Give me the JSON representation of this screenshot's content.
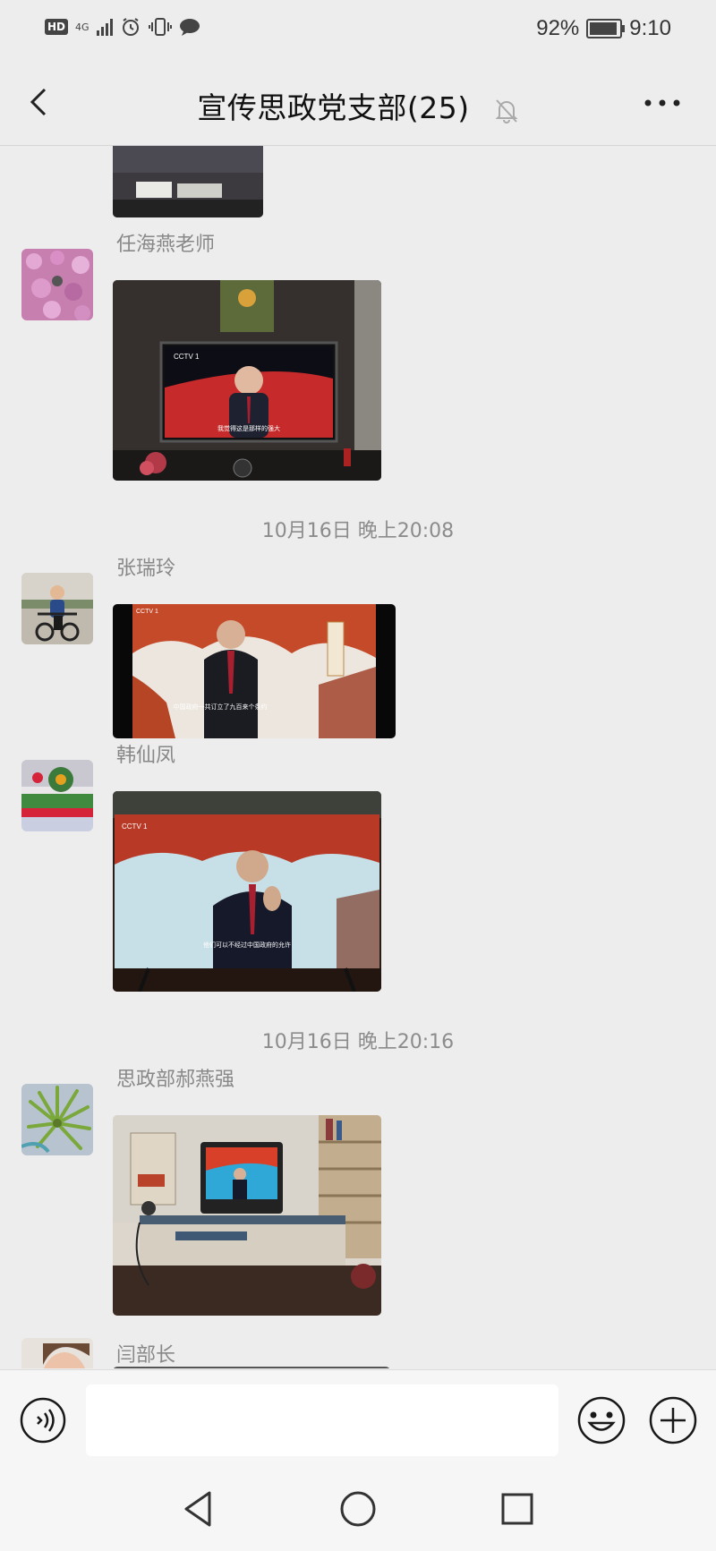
{
  "status_bar": {
    "hd": "HD",
    "network": "4G",
    "battery": "92%",
    "battery_level": 0.92,
    "time": "9:10"
  },
  "header": {
    "title": "宣传思政党支部(25)",
    "back_icon": "chevron-left-icon",
    "mute_icon": "bell-muted-icon",
    "more_icon": "more-dots-icon"
  },
  "messages": [
    {
      "sender": "任海燕老师"
    },
    {
      "time": "10月16日 晚上20:08"
    },
    {
      "sender": "张瑞玲"
    },
    {
      "sender": "韩仙凤"
    },
    {
      "time": "10月16日 晚上20:16"
    },
    {
      "sender": "思政部郝燕强"
    },
    {
      "sender": "闫部长"
    }
  ],
  "photo_captions": {
    "tv1_channel": "CCTV 1",
    "tv1_subtitle": "我觉得这是那样的强大",
    "tv2_channel": "CCTV 1",
    "tv2_subtitle": "中国政府一共订立了九百来个条约",
    "tv3_channel": "CCTV 1",
    "tv3_subtitle": "他们可以不经过中国政府的允许"
  },
  "input_bar": {
    "voice_icon": "voice-icon",
    "emoji_icon": "emoji-icon",
    "plus_icon": "plus-icon"
  },
  "nav_bar": {
    "back_icon": "triangle-back-icon",
    "home_icon": "circle-home-icon",
    "recents_icon": "square-recents-icon"
  },
  "colors": {
    "background": "#ededed",
    "tv_red": "#d42a2a",
    "text_gray": "#888888"
  }
}
